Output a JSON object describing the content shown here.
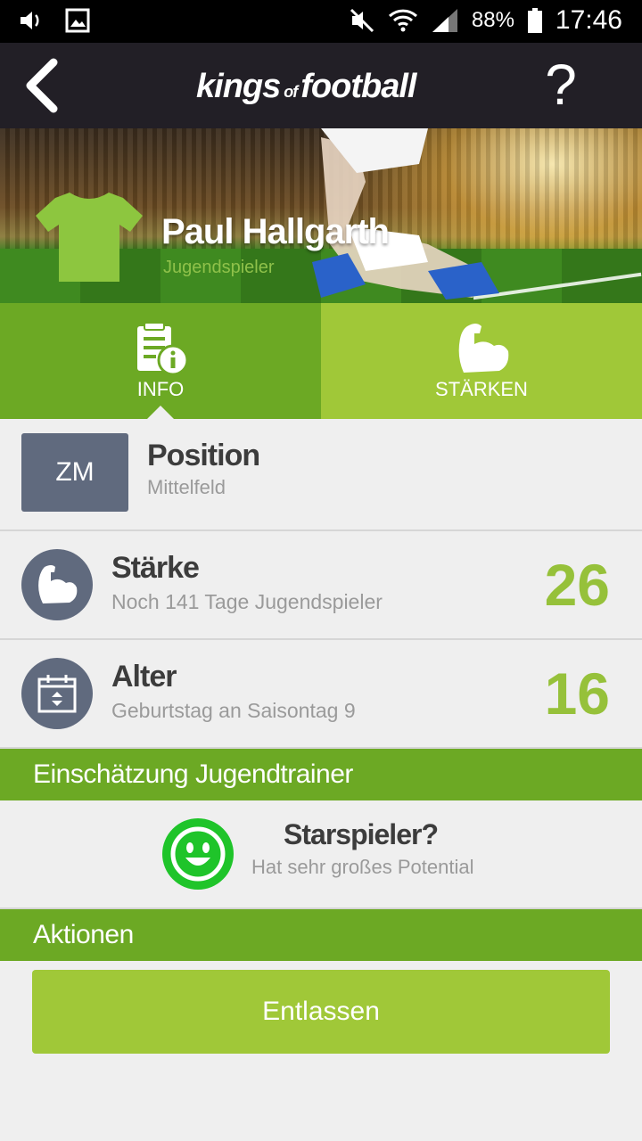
{
  "status_bar": {
    "battery": "88%",
    "time": "17:46",
    "icons": [
      "volume-icon",
      "image-icon",
      "mute-icon",
      "wifi-icon",
      "signal-icon",
      "battery-icon"
    ]
  },
  "app_bar": {
    "logo_part1": "kings",
    "logo_of": "of",
    "logo_part2": "football",
    "help_label": "?"
  },
  "player": {
    "name": "Paul Hallgarth",
    "role": "Jugendspieler",
    "jersey_color": "#8dc63f"
  },
  "tabs": [
    {
      "label": "INFO",
      "icon": "info-document-icon",
      "active": true
    },
    {
      "label": "STÄRKEN",
      "icon": "muscle-arm-icon",
      "active": false
    }
  ],
  "rows": {
    "position": {
      "badge": "ZM",
      "title": "Position",
      "subtitle": "Mittelfeld"
    },
    "staerke": {
      "title": "Stärke",
      "subtitle": "Noch 141 Tage Jugendspieler",
      "value": "26",
      "icon": "muscle-arm-icon"
    },
    "alter": {
      "title": "Alter",
      "subtitle": "Geburtstag an Saisontag 9",
      "value": "16",
      "icon": "calendar-icon"
    }
  },
  "assessment": {
    "header": "Einschätzung Jugendtrainer",
    "title": "Starspieler?",
    "subtitle": "Hat sehr großes Potential",
    "icon": "smiley-icon"
  },
  "actions": {
    "header": "Aktionen",
    "fire_label": "Entlassen"
  },
  "colors": {
    "dark_green": "#6ca924",
    "light_green": "#a0c838",
    "value_green": "#96c13a",
    "slate": "#606a7e",
    "smiley_green": "#1fc42a"
  }
}
